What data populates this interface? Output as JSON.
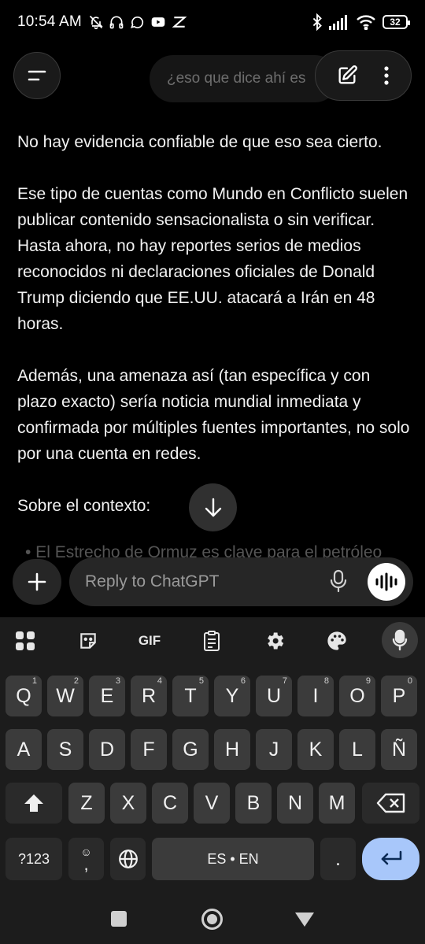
{
  "status_bar": {
    "time": "10:54 AM",
    "left_icons": [
      "mute-bell-icon",
      "headphones-icon",
      "whatsapp-icon",
      "youtube-icon",
      "app-icon"
    ],
    "right_icons": [
      "bluetooth-icon",
      "signal-icon",
      "wifi-icon"
    ],
    "battery": "32"
  },
  "top_bar": {
    "hint_text": "¿eso que dice ahí es",
    "icons": [
      "menu-icon",
      "edit-icon",
      "more-vertical-icon"
    ]
  },
  "message": {
    "paragraphs": [
      "No hay evidencia confiable de que eso sea cierto.",
      "Ese tipo de cuentas como Mundo en Conflicto suelen publicar contenido sensacionalista o sin verificar. Hasta ahora, no hay reportes serios de medios reconocidos ni declaraciones oficiales de Donald Trump diciendo que EE.UU. atacará a Irán en 48 horas.",
      "Además, una amenaza así (tan específica y con plazo exacto) sería noticia mundial inmediata y confirmada por múltiples fuentes importantes, no solo por una cuenta en redes.",
      "Sobre el contexto:"
    ],
    "faded_bullet": "•  El Estrecho de Ormuz es clave para el petróleo"
  },
  "composer": {
    "placeholder": "Reply to ChatGPT"
  },
  "keyboard": {
    "toolbar": {
      "gif_label": "GIF"
    },
    "row1": [
      {
        "k": "Q",
        "s": "1"
      },
      {
        "k": "W",
        "s": "2"
      },
      {
        "k": "E",
        "s": "3"
      },
      {
        "k": "R",
        "s": "4"
      },
      {
        "k": "T",
        "s": "5"
      },
      {
        "k": "Y",
        "s": "6"
      },
      {
        "k": "U",
        "s": "7"
      },
      {
        "k": "I",
        "s": "8"
      },
      {
        "k": "O",
        "s": "9"
      },
      {
        "k": "P",
        "s": "0"
      }
    ],
    "row2": [
      "A",
      "S",
      "D",
      "F",
      "G",
      "H",
      "J",
      "K",
      "L",
      "Ñ"
    ],
    "row3": [
      "Z",
      "X",
      "C",
      "V",
      "B",
      "N",
      "M"
    ],
    "symbols_label": "?123",
    "comma_label": ",",
    "space_label": "ES • EN",
    "period_label": ".",
    "accent_color": "#a8c7fa"
  }
}
